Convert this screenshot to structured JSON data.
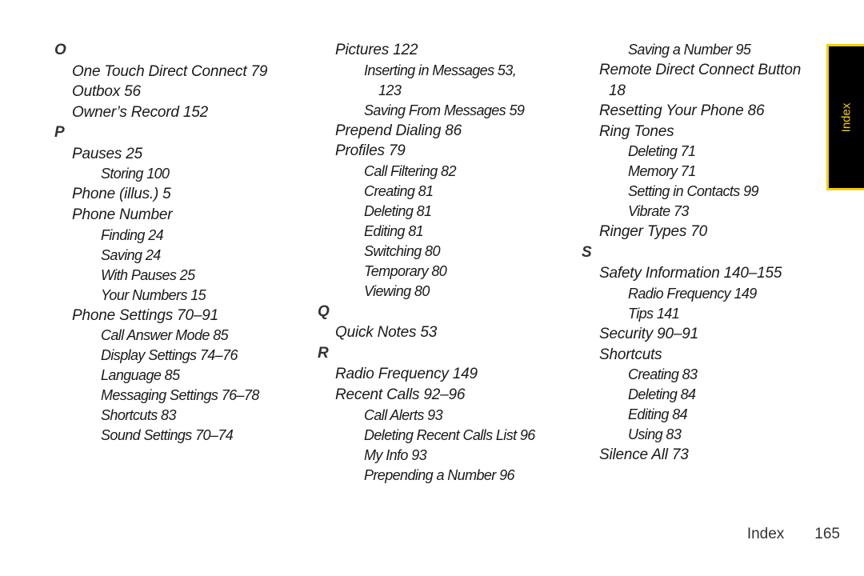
{
  "section_tab": {
    "label": "Index",
    "bg_color": "#000000",
    "accent_color": "#f5d000"
  },
  "footer": {
    "section": "Index",
    "page_number": "165"
  },
  "columns": [
    [
      {
        "type": "letter",
        "text": "O"
      },
      {
        "type": "lvl1",
        "text": "One Touch Direct Connect 79"
      },
      {
        "type": "lvl1",
        "text": "Outbox 56"
      },
      {
        "type": "lvl1",
        "text": "Owner’s Record 152"
      },
      {
        "type": "letter",
        "text": "P"
      },
      {
        "type": "lvl1",
        "text": "Pauses 25"
      },
      {
        "type": "lvl2",
        "text": "Storing 100"
      },
      {
        "type": "lvl1",
        "text": "Phone (illus.) 5"
      },
      {
        "type": "lvl1",
        "text": "Phone Number"
      },
      {
        "type": "lvl2",
        "text": "Finding 24"
      },
      {
        "type": "lvl2",
        "text": "Saving 24"
      },
      {
        "type": "lvl2",
        "text": "With Pauses 25"
      },
      {
        "type": "lvl2",
        "text": "Your Numbers 15"
      },
      {
        "type": "lvl1",
        "text": "Phone Settings 70–91"
      },
      {
        "type": "lvl2",
        "text": "Call Answer Mode 85"
      },
      {
        "type": "lvl2",
        "text": "Display Settings 74–76"
      },
      {
        "type": "lvl2",
        "text": "Language 85"
      },
      {
        "type": "lvl2",
        "text": "Messaging Settings 76–78"
      },
      {
        "type": "lvl2",
        "text": "Shortcuts 83"
      },
      {
        "type": "lvl2",
        "text": "Sound Settings 70–74"
      }
    ],
    [
      {
        "type": "lvl1",
        "text": "Pictures 122"
      },
      {
        "type": "lvl2",
        "text": "Inserting in Messages 53,"
      },
      {
        "type": "cont2",
        "text": "123"
      },
      {
        "type": "lvl2",
        "text": "Saving From Messages 59"
      },
      {
        "type": "lvl1",
        "text": "Prepend Dialing 86"
      },
      {
        "type": "lvl1",
        "text": "Profiles 79"
      },
      {
        "type": "lvl2",
        "text": "Call Filtering 82"
      },
      {
        "type": "lvl2",
        "text": "Creating 81"
      },
      {
        "type": "lvl2",
        "text": "Deleting 81"
      },
      {
        "type": "lvl2",
        "text": "Editing 81"
      },
      {
        "type": "lvl2",
        "text": "Switching 80"
      },
      {
        "type": "lvl2",
        "text": "Temporary 80"
      },
      {
        "type": "lvl2",
        "text": "Viewing 80"
      },
      {
        "type": "letter",
        "text": "Q"
      },
      {
        "type": "lvl1",
        "text": "Quick Notes 53"
      },
      {
        "type": "letter",
        "text": "R"
      },
      {
        "type": "lvl1",
        "text": "Radio Frequency 149"
      },
      {
        "type": "lvl1",
        "text": "Recent Calls 92–96"
      },
      {
        "type": "lvl2",
        "text": "Call Alerts 93"
      },
      {
        "type": "lvl2",
        "text": "Deleting Recent Calls List 96"
      },
      {
        "type": "lvl2",
        "text": "My Info 93"
      },
      {
        "type": "lvl2",
        "text": "Prepending a Number 96"
      }
    ],
    [
      {
        "type": "lvl2",
        "text": "Saving a Number 95"
      },
      {
        "type": "lvl1",
        "text": "Remote Direct Connect Button"
      },
      {
        "type": "cont1",
        "text": "18"
      },
      {
        "type": "lvl1",
        "text": "Resetting Your Phone 86"
      },
      {
        "type": "lvl1",
        "text": "Ring Tones"
      },
      {
        "type": "lvl2",
        "text": "Deleting 71"
      },
      {
        "type": "lvl2",
        "text": "Memory 71"
      },
      {
        "type": "lvl2",
        "text": "Setting in Contacts 99"
      },
      {
        "type": "lvl2",
        "text": "Vibrate 73"
      },
      {
        "type": "lvl1",
        "text": "Ringer Types 70"
      },
      {
        "type": "letter",
        "text": "S"
      },
      {
        "type": "lvl1",
        "text": "Safety Information 140–155"
      },
      {
        "type": "lvl2",
        "text": "Radio Frequency 149"
      },
      {
        "type": "lvl2",
        "text": "Tips 141"
      },
      {
        "type": "lvl1",
        "text": "Security 90–91"
      },
      {
        "type": "lvl1",
        "text": "Shortcuts"
      },
      {
        "type": "lvl2",
        "text": "Creating 83"
      },
      {
        "type": "lvl2",
        "text": "Deleting 84"
      },
      {
        "type": "lvl2",
        "text": "Editing 84"
      },
      {
        "type": "lvl2",
        "text": "Using 83"
      },
      {
        "type": "lvl1",
        "text": "Silence All 73"
      }
    ]
  ]
}
